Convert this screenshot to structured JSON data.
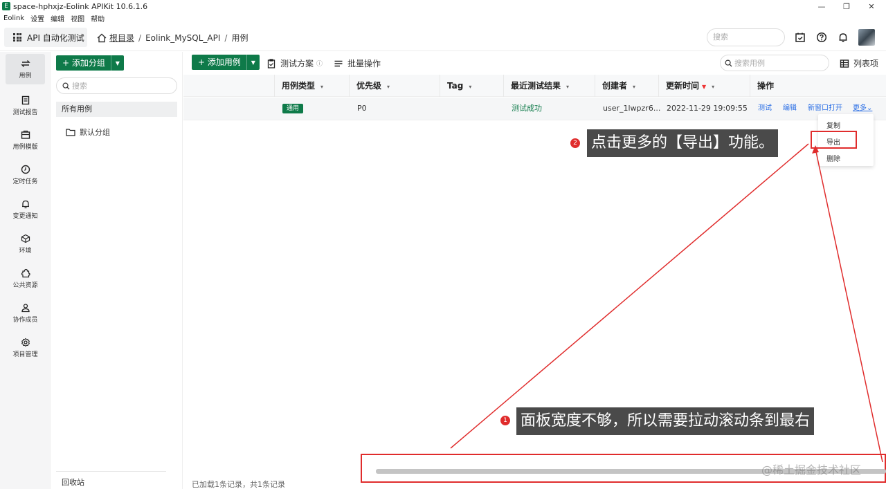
{
  "window": {
    "title": "space-hphxjz-Eolink APIKit 10.6.1.6",
    "minimize": "—",
    "restore": "❐",
    "close": "✕"
  },
  "menu": [
    "Eolink",
    "设置",
    "编辑",
    "视图",
    "帮助"
  ],
  "header": {
    "module": "API 自动化测试",
    "breadcrumb": {
      "root": "根目录",
      "sep": "/",
      "project": "Eolink_MySQL_API",
      "current": "用例"
    },
    "search_placeholder": "搜索"
  },
  "leftnav": [
    {
      "label": "用例",
      "icon": "swap-icon"
    },
    {
      "label": "测试报告",
      "icon": "report-icon"
    },
    {
      "label": "用例模版",
      "icon": "template-icon"
    },
    {
      "label": "定时任务",
      "icon": "clock-icon"
    },
    {
      "label": "变更通知",
      "icon": "bell-icon"
    },
    {
      "label": "环境",
      "icon": "cube-icon"
    },
    {
      "label": "公共资源",
      "icon": "puzzle-icon"
    },
    {
      "label": "协作成员",
      "icon": "user-icon"
    },
    {
      "label": "项目管理",
      "icon": "gear-icon"
    }
  ],
  "groups": {
    "add_button": "+ 添加分组",
    "search_placeholder": "搜索",
    "all": "所有用例",
    "default": "默认分组",
    "recycle": "回收站"
  },
  "toolbar": {
    "add_case": "+ 添加用例",
    "test_plan": "测试方案",
    "test_plan_info": "ⓘ",
    "batch": "批量操作",
    "search_placeholder": "搜索用例",
    "columns": "列表项"
  },
  "table": {
    "headers": [
      "用例类型",
      "优先级",
      "Tag",
      "最近测试结果",
      "创建者",
      "更新时间",
      "操作"
    ],
    "row": {
      "type": "通用",
      "priority": "P0",
      "tag": "",
      "result": "测试成功",
      "creator": "user_1lwpzr6...",
      "updated": "2022-11-29 19:09:55",
      "ops": [
        "测试",
        "编辑",
        "新窗口打开",
        "更多⌄"
      ]
    }
  },
  "dropdown": [
    "复制",
    "导出",
    "删除"
  ],
  "annotations": {
    "step1_num": "1",
    "step1": "面板宽度不够，所以需要拉动滚动条到最右",
    "step2_num": "2",
    "step2": "点击更多的【导出】功能。"
  },
  "footer": "已加载1条记录，共1条记录",
  "watermark": "@稀土掘金技术社区",
  "colors": {
    "brand": "#0e7a49",
    "link": "#2a6ee5",
    "annotation": "#e02c2c"
  }
}
